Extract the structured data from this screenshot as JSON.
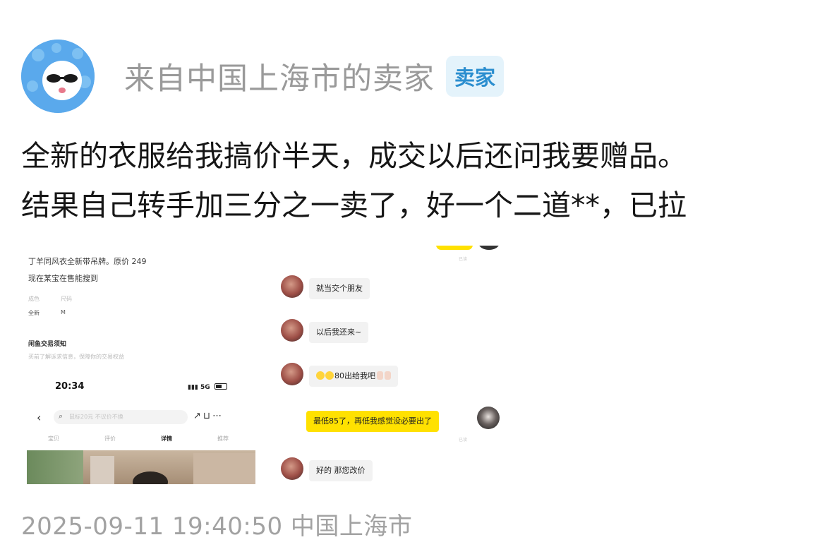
{
  "post": {
    "username": "来自中国上海市的卖家",
    "badge": "卖家",
    "text_line1": "全新的衣服给我搞价半天，成交以后还问我要赠品。",
    "text_line2": "结果自己转手加三分之一卖了，好一个二道**，已拉",
    "timestamp": "2025-09-11 19:40:50 中国上海市"
  },
  "listing": {
    "line1": "丁羊同风衣全新带吊牌。原价 249",
    "line2": "现在某宝在售能搜到",
    "spec_labels": [
      "成色",
      "尺码"
    ],
    "spec_values": [
      "全新",
      "M"
    ],
    "notice_title": "闲鱼交易须知",
    "notice_text": "买前了解诉求信息，保障你的交易权益",
    "clock": "20:34",
    "network": "5G",
    "search_placeholder": "鼠标20元 不议价不换",
    "tabs": [
      "宝贝",
      "评价",
      "详情",
      "推荐"
    ],
    "active_tab": "详情"
  },
  "chat": {
    "top_time": "已读",
    "messages": [
      {
        "from": "buyer",
        "text": "就当交个朋友"
      },
      {
        "from": "buyer",
        "text": "以后我还来~"
      },
      {
        "from": "buyer",
        "text": "80出给我吧"
      },
      {
        "from": "seller",
        "text": "最低85了，再低我感觉没必要出了",
        "status": "已读"
      },
      {
        "from": "buyer",
        "text": "好的 那您改价"
      }
    ]
  },
  "colors": {
    "username": "#9a9a9a",
    "badge_bg": "#e4f3fb",
    "badge_text": "#2b8ecf",
    "seller_bubble": "#ffe100",
    "buyer_bubble": "#f2f2f2",
    "avatar_bg": "#5aa9ec"
  }
}
